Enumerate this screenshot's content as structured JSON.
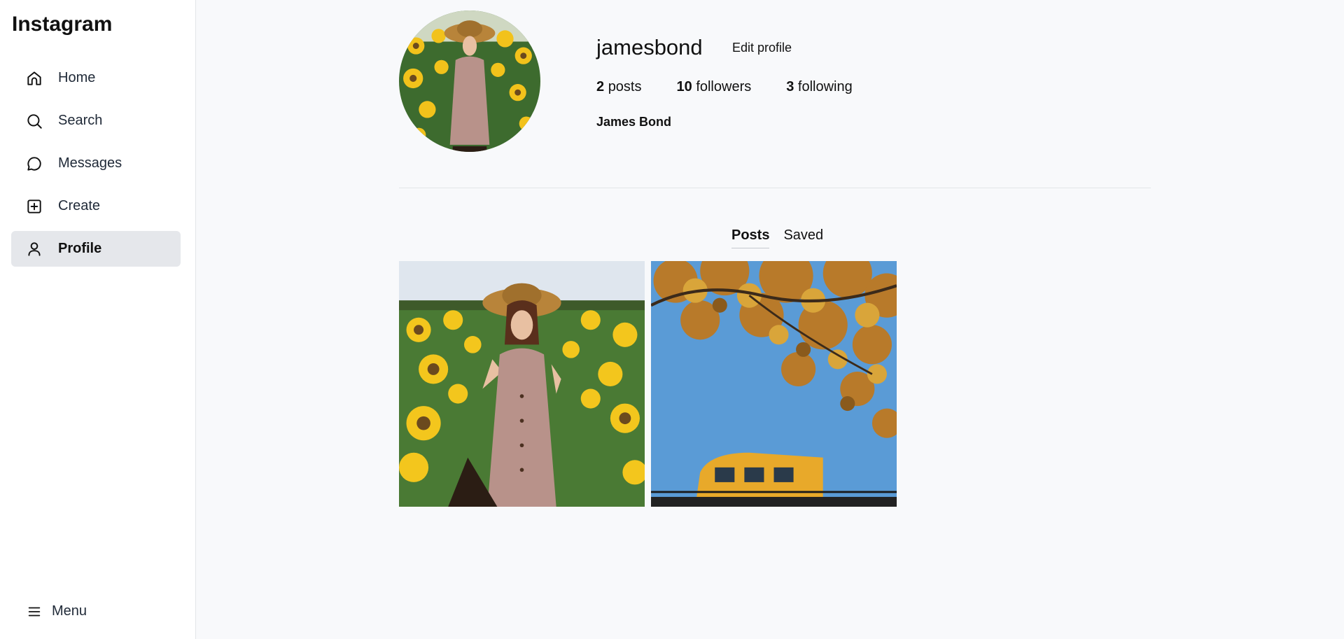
{
  "app": {
    "logo": "Instagram"
  },
  "sidebar": {
    "items": [
      {
        "label": "Home",
        "icon": "home-icon"
      },
      {
        "label": "Search",
        "icon": "search-icon"
      },
      {
        "label": "Messages",
        "icon": "message-circle-icon"
      },
      {
        "label": "Create",
        "icon": "plus-square-icon"
      },
      {
        "label": "Profile",
        "icon": "user-icon",
        "active": true
      }
    ],
    "menu_label": "Menu"
  },
  "profile": {
    "username": "jamesbond",
    "edit_label": "Edit profile",
    "posts_count": "2",
    "posts_label": "posts",
    "followers_count": "10",
    "followers_label": "followers",
    "following_count": "3",
    "following_label": "following",
    "full_name": "James Bond"
  },
  "tabs": [
    {
      "label": "Posts",
      "active": true
    },
    {
      "label": "Saved",
      "active": false
    }
  ],
  "posts": [
    {
      "image": "woman-in-sunflower-field-photo"
    },
    {
      "image": "autumn-tree-and-yellow-train-photo"
    }
  ]
}
